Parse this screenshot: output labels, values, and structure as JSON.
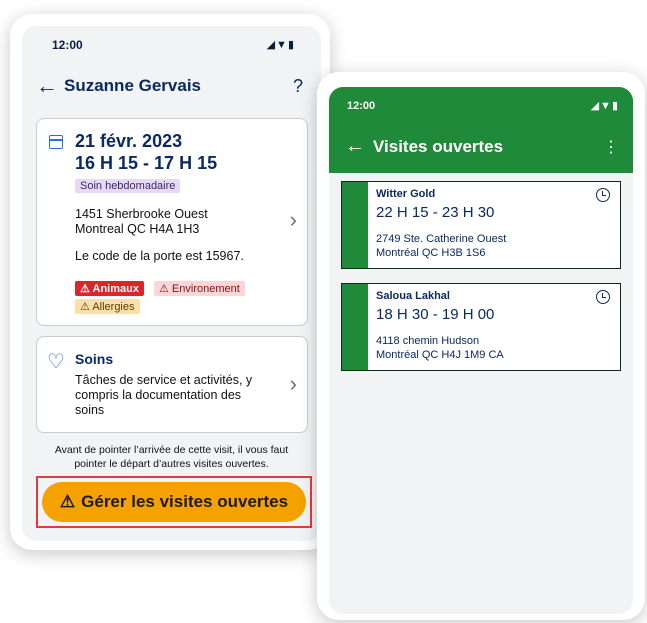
{
  "left_screen": {
    "status_time": "12:00",
    "status_icons": "◢▼▮",
    "back_icon": "←",
    "title": "Suzanne Gervais",
    "help_label": "?",
    "visit_card": {
      "date": "21 févr. 2023",
      "hours": "16 H 15 - 17 H 15",
      "tag": "Soin hebdomadaire",
      "address_line1": "1451 Sherbrooke Ouest",
      "address_line2": "Montreal QC H4A 1H3",
      "door_code": "Le code de la porte est 15967.",
      "badges": [
        "Animaux",
        "Environement",
        "Allergies"
      ],
      "chevron": "›"
    },
    "care_card": {
      "title": "Soins",
      "description": "Tâches de service et activités, y compris la documentation des soins",
      "chevron": "›"
    },
    "notice": "Avant de pointer l’arrivée de cette visit, il vous faut pointer le départ d’autres visites ouvertes.",
    "cta_label": "Gérer les visites ouvertes",
    "colors": {
      "cta": "#f5a100",
      "highlight_border": "#e03c3c",
      "title": "#0b2a63"
    }
  },
  "right_screen": {
    "status_time": "12:00",
    "status_icons": "◢▼▮",
    "back_icon": "←",
    "title": "Visites ouvertes",
    "menu_icon": "⋮",
    "visits": [
      {
        "name": "Witter Gold",
        "hours": "22 H 15 - 23 H 30",
        "address_line1": "2749  Ste. Catherine Ouest",
        "address_line2": "Montréal QC H3B 1S6"
      },
      {
        "name": "Saloua Lakhal",
        "hours": "18 H 30 - 19 H 00",
        "address_line1": "4118 chemin Hudson",
        "address_line2": "Montréal QC H4J 1M9 CA"
      }
    ],
    "colors": {
      "header": "#1f8a3a"
    }
  }
}
